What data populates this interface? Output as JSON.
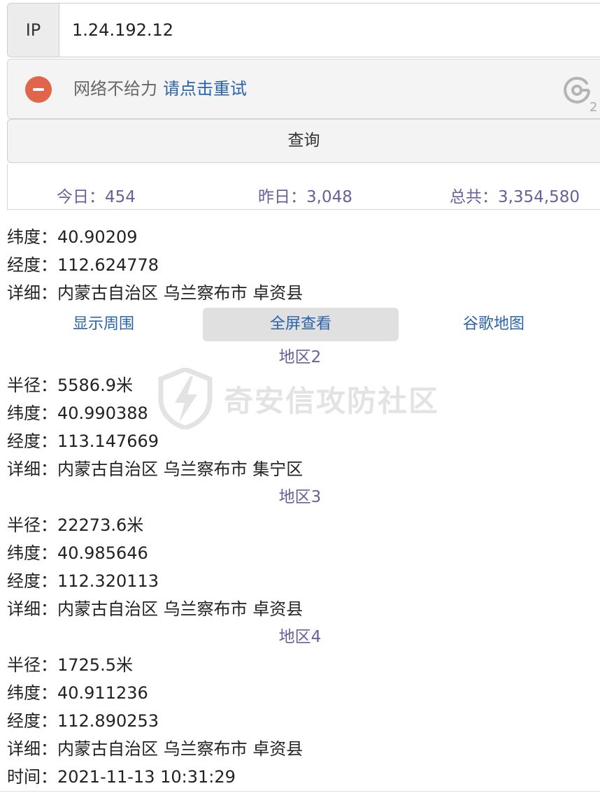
{
  "header": {
    "ip_label": "IP",
    "ip_value": "1.24.192.12",
    "error": {
      "message": "网络不给力",
      "retry_link": "请点击重试",
      "refresh_count": "2"
    },
    "query_button": "查询",
    "stats": {
      "today": "今日：454",
      "yesterday": "昨日：3,048",
      "total": "总共：3,354,580"
    }
  },
  "region1": {
    "latitude": "纬度：40.90209",
    "longitude": "经度：112.624778",
    "detail": "详细：内蒙古自治区 乌兰察布市 卓资县"
  },
  "links": {
    "show_around": "显示周围",
    "fullscreen": "全屏查看",
    "google_map": "谷歌地图"
  },
  "region2": {
    "title": "地区2",
    "radius": "半径：5586.9米",
    "latitude": "纬度：40.990388",
    "longitude": "经度：113.147669",
    "detail": "详细：内蒙古自治区 乌兰察布市 集宁区"
  },
  "region3": {
    "title": "地区3",
    "radius": "半径：22273.6米",
    "latitude": "纬度：40.985646",
    "longitude": "经度：112.320113",
    "detail": "详细：内蒙古自治区 乌兰察布市 卓资县"
  },
  "region4": {
    "title": "地区4",
    "radius": "半径：1725.5米",
    "latitude": "纬度：40.911236",
    "longitude": "经度：112.890253",
    "detail": "详细：内蒙古自治区 乌兰察布市 卓资县"
  },
  "time": "时间：2021-11-13 10:31:29",
  "watermark": "奇安信攻防社区",
  "colors": {
    "link_blue": "#2a63ad",
    "region_purple": "#6a5f9b",
    "error_red": "#e0654a"
  }
}
